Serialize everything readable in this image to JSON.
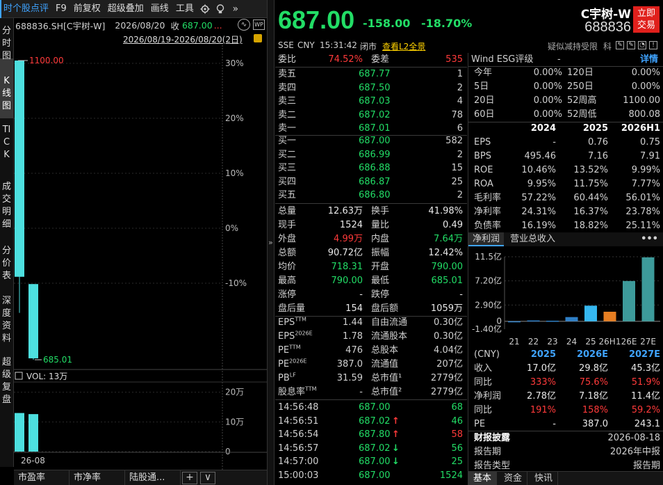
{
  "toolbar": {
    "items": [
      "时个股点评",
      "F9",
      "前复权",
      "超级叠加",
      "画线",
      "工具"
    ],
    "gear_icon": "gear-icon",
    "bulb_icon": "bulb-icon",
    "expand_icon": "double-chevron-right-icon"
  },
  "chart_sub": {
    "code": "688836.SH[C宇树-W]",
    "date": "2026/08/20",
    "close_label": "收",
    "close_value": "687.00",
    "dots": "...",
    "range": "2026/08/19-2026/08/20(2日)"
  },
  "vtabs": [
    "分时图",
    "K线图",
    "TICK",
    "成交明细",
    "分价表",
    "深度资料",
    "超级复盘"
  ],
  "kline": {
    "high_label": "1100.00",
    "low_label": "685.01",
    "pct_ticks": [
      "30%",
      "20%",
      "10%",
      "0%",
      "-10%"
    ],
    "vol_label": "VOL: 13万",
    "vol_ticks": [
      "20万",
      "10万",
      "0"
    ],
    "date_label": "26-08",
    "bars": [
      {
        "open": 800.08,
        "close": 1100.0,
        "high": 1100.0,
        "low": 750.0,
        "volume": 13.0
      },
      {
        "open": 790.0,
        "close": 687.0,
        "high": 790.0,
        "low": 685.01,
        "volume": 12.63
      }
    ],
    "pct_base": 0.0,
    "colors": {
      "up": "#4ddfdf",
      "down": "#4ddfdf",
      "red_label": "#ff3a3a",
      "green_label": "#22dd66"
    }
  },
  "bottom_tabs": [
    "市盈率",
    "市净率",
    "陆股通..."
  ],
  "bottom_btns": [
    "+",
    "∨"
  ],
  "divider_arrow": "»",
  "quote": {
    "price": "687.00",
    "change": "-158.00",
    "change_pct": "-18.70%",
    "name": "C宇树-W",
    "code": "688836",
    "trade_btn_1": "立即",
    "trade_btn_2": "交易",
    "exchange": "SSE",
    "currency": "CNY",
    "time": "15:31:42",
    "status": "闭市",
    "l2": "查看L2全景",
    "suspect": "疑似减持受限",
    "industry": "科"
  },
  "orderbook": {
    "weibi_label": "委比",
    "weibi": "74.52%",
    "weicha_label": "委差",
    "weicha": "535",
    "asks": [
      {
        "label": "卖五",
        "price": "687.77",
        "vol": "1"
      },
      {
        "label": "卖四",
        "price": "687.50",
        "vol": "2"
      },
      {
        "label": "卖三",
        "price": "687.03",
        "vol": "4"
      },
      {
        "label": "卖二",
        "price": "687.02",
        "vol": "78"
      },
      {
        "label": "卖一",
        "price": "687.01",
        "vol": "6"
      }
    ],
    "bids": [
      {
        "label": "买一",
        "price": "687.00",
        "vol": "582"
      },
      {
        "label": "买二",
        "price": "686.99",
        "vol": "2"
      },
      {
        "label": "买三",
        "price": "686.88",
        "vol": "15"
      },
      {
        "label": "买四",
        "price": "686.87",
        "vol": "25"
      },
      {
        "label": "买五",
        "price": "686.80",
        "vol": "2"
      }
    ]
  },
  "stats": [
    {
      "l1": "总量",
      "v1": "12.63万",
      "c1": "white",
      "l2": "换手",
      "v2": "41.98%",
      "c2": "white"
    },
    {
      "l1": "现手",
      "v1": "1524",
      "c1": "white",
      "l2": "量比",
      "v2": "0.49",
      "c2": "white"
    },
    {
      "l1": "外盘",
      "v1": "4.99万",
      "c1": "red",
      "l2": "内盘",
      "v2": "7.64万",
      "c2": "green"
    },
    {
      "l1": "总额",
      "v1": "90.72亿",
      "c1": "white",
      "l2": "振幅",
      "v2": "12.42%",
      "c2": "white"
    },
    {
      "l1": "均价",
      "v1": "718.31",
      "c1": "green",
      "l2": "开盘",
      "v2": "790.00",
      "c2": "green"
    },
    {
      "l1": "最高",
      "v1": "790.00",
      "c1": "green",
      "l2": "最低",
      "v2": "685.01",
      "c2": "green"
    },
    {
      "l1": "涨停",
      "v1": "-",
      "c1": "white",
      "l2": "跌停",
      "v2": "-",
      "c2": "white"
    },
    {
      "l1": "盘后量",
      "v1": "154",
      "c1": "white",
      "l2": "盘后额",
      "v2": "1059万",
      "c2": "white"
    }
  ],
  "fund": [
    {
      "l1": "EPS",
      "s1": "TTM",
      "v1": "1.44",
      "l2": "自由流通",
      "v2": "0.30亿"
    },
    {
      "l1": "EPS",
      "s1": "2026E",
      "v1": "1.78",
      "l2": "流通股本",
      "v2": "0.30亿"
    },
    {
      "l1": "PE",
      "s1": "TTM",
      "v1": "476",
      "l2": "总股本",
      "v2": "4.04亿"
    },
    {
      "l1": "PE",
      "s1": "2026E",
      "v1": "387.0",
      "l2": "流通值",
      "v2": "207亿"
    },
    {
      "l1": "PB",
      "s1": "LF",
      "v1": "31.59",
      "l2": "总市值¹",
      "v2": "2779亿"
    },
    {
      "l1": "股息率",
      "s1": "TTM",
      "v1": "-",
      "l2": "总市值²",
      "v2": "2779亿"
    }
  ],
  "ticks": [
    {
      "time": "14:56:48",
      "price": "687.00",
      "arrow": "",
      "vol": "68",
      "vc": "green"
    },
    {
      "time": "14:56:51",
      "price": "687.02",
      "arrow": "up",
      "vol": "46",
      "vc": "green"
    },
    {
      "time": "14:56:54",
      "price": "687.80",
      "arrow": "up",
      "vol": "58",
      "vc": "red"
    },
    {
      "time": "14:56:57",
      "price": "687.02",
      "arrow": "down",
      "vol": "56",
      "vc": "green"
    },
    {
      "time": "14:57:00",
      "price": "687.00",
      "arrow": "down",
      "vol": "25",
      "vc": "green"
    },
    {
      "time": "15:00:03",
      "price": "687.00",
      "arrow": "",
      "vol": "1524",
      "vc": "green"
    }
  ],
  "esg": {
    "label": "Wind ESG评级",
    "value": "-",
    "detail": "详情"
  },
  "perf": [
    {
      "l1": "今年",
      "v1": "0.00%",
      "l2": "120日",
      "v2": "0.00%"
    },
    {
      "l1": "5日",
      "v1": "0.00%",
      "l2": "250日",
      "v2": "0.00%"
    },
    {
      "l1": "20日",
      "v1": "0.00%",
      "l2": "52周高",
      "v2": "1100.00"
    },
    {
      "l1": "60日",
      "v1": "0.00%",
      "l2": "52周低",
      "v2": "800.08"
    }
  ],
  "fin_table": {
    "years": [
      "2024",
      "2025",
      "2026H1"
    ],
    "rows": [
      {
        "label": "EPS",
        "vals": [
          "-",
          "0.76",
          "0.75"
        ]
      },
      {
        "label": "BPS",
        "vals": [
          "495.46",
          "7.16",
          "7.91"
        ]
      },
      {
        "label": "ROE",
        "vals": [
          "10.46%",
          "13.52%",
          "9.99%"
        ]
      },
      {
        "label": "ROA",
        "vals": [
          "9.95%",
          "11.75%",
          "7.77%"
        ]
      },
      {
        "label": "毛利率",
        "vals": [
          "57.22%",
          "60.44%",
          "56.01%"
        ]
      },
      {
        "label": "净利率",
        "vals": [
          "24.31%",
          "16.37%",
          "23.78%"
        ]
      },
      {
        "label": "负债率",
        "vals": [
          "16.19%",
          "18.82%",
          "25.11%"
        ]
      }
    ]
  },
  "profit_tabs": {
    "active": "净利润",
    "other": "营业总收入",
    "more": "•••"
  },
  "chart_data": {
    "type": "bar",
    "categories": [
      "21",
      "22",
      "23",
      "24",
      "25",
      "26H1",
      "26E",
      "27E"
    ],
    "values": [
      0.0,
      0.15,
      0.1,
      0.75,
      2.78,
      1.7,
      7.18,
      11.4
    ],
    "yticks": [
      "11.5亿",
      "7.20亿",
      "2.90亿",
      "0",
      "-1.40亿"
    ],
    "ylim": [
      -1.4,
      11.5
    ],
    "colors": {
      "hist": "#2f7fc6",
      "h1": "#e67e22",
      "est": "#3d9a9a"
    }
  },
  "forecast": {
    "unit": "(CNY)",
    "years": [
      "2025",
      "2026E",
      "2027E"
    ],
    "rows": [
      {
        "label": "收入",
        "vals": [
          "17.0亿",
          "29.8亿",
          "45.3亿"
        ],
        "color": "white"
      },
      {
        "label": "同比",
        "vals": [
          "333%",
          "75.6%",
          "51.9%"
        ],
        "color": "red"
      },
      {
        "label": "净利润",
        "vals": [
          "2.78亿",
          "7.18亿",
          "11.4亿"
        ],
        "color": "white"
      },
      {
        "label": "同比",
        "vals": [
          "191%",
          "158%",
          "59.2%"
        ],
        "color": "red"
      },
      {
        "label": "PE",
        "vals": [
          "-",
          "387.0",
          "243.1"
        ],
        "color": "white"
      }
    ]
  },
  "disclosure": {
    "title": "财报披露",
    "date": "2026-08-18",
    "period_label": "报告期",
    "period": "2026年中报",
    "type_label": "报告类型",
    "type": "报告期"
  },
  "right_bottom_tabs": [
    "基本",
    "资金",
    "快讯"
  ]
}
